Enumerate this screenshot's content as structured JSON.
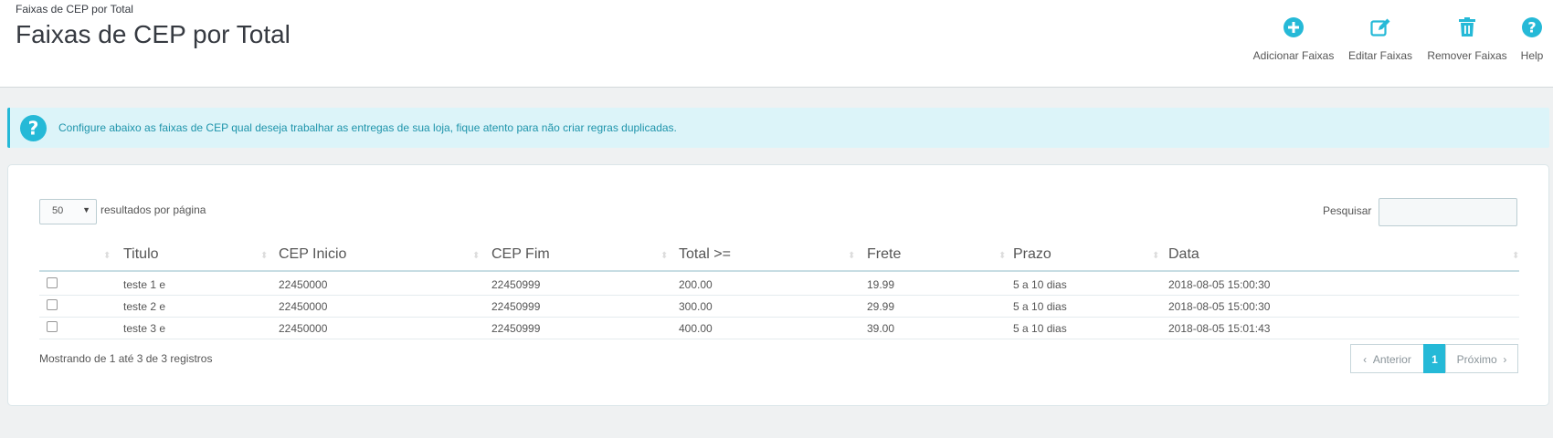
{
  "header": {
    "breadcrumb": "Faixas de CEP por Total",
    "title": "Faixas de CEP por Total"
  },
  "toolbar": {
    "add_label": "Adicionar Faixas",
    "add_icon": "plus-circle-icon",
    "edit_label": "Editar Faixas",
    "edit_icon": "edit-pencil-icon",
    "remove_label": "Remover Faixas",
    "remove_icon": "trash-icon",
    "help_label": "Help",
    "help_icon": "question-circle-icon"
  },
  "alert": {
    "icon": "question-circle-icon",
    "message": "Configure abaixo as faixas de CEP qual deseja trabalhar as entregas de sua loja, fique atento para não criar regras duplicadas."
  },
  "table_controls": {
    "page_length": "50",
    "page_length_label": "resultados por página",
    "search_label": "Pesquisar",
    "search_value": ""
  },
  "table": {
    "columns": [
      "Titulo",
      "CEP Inicio",
      "CEP Fim",
      "Total >=",
      "Frete",
      "Prazo",
      "Data"
    ],
    "rows": [
      {
        "titulo": "teste 1 e",
        "cep_inicio": "22450000",
        "cep_fim": "22450999",
        "total": "200.00",
        "frete": "19.99",
        "prazo": "5 a 10 dias",
        "data": "2018-08-05 15:00:30"
      },
      {
        "titulo": "teste 2 e",
        "cep_inicio": "22450000",
        "cep_fim": "22450999",
        "total": "300.00",
        "frete": "29.99",
        "prazo": "5 a 10 dias",
        "data": "2018-08-05 15:00:30"
      },
      {
        "titulo": "teste 3 e",
        "cep_inicio": "22450000",
        "cep_fim": "22450999",
        "total": "400.00",
        "frete": "39.00",
        "prazo": "5 a 10 dias",
        "data": "2018-08-05 15:01:43"
      }
    ]
  },
  "footer": {
    "info": "Mostrando de 1 até 3 de 3 registros",
    "prev_label": "Anterior",
    "current_page": "1",
    "next_label": "Próximo"
  },
  "colors": {
    "accent": "#25b9d7",
    "alert_bg": "#dcf4f9",
    "alert_text": "#1e94ab"
  }
}
